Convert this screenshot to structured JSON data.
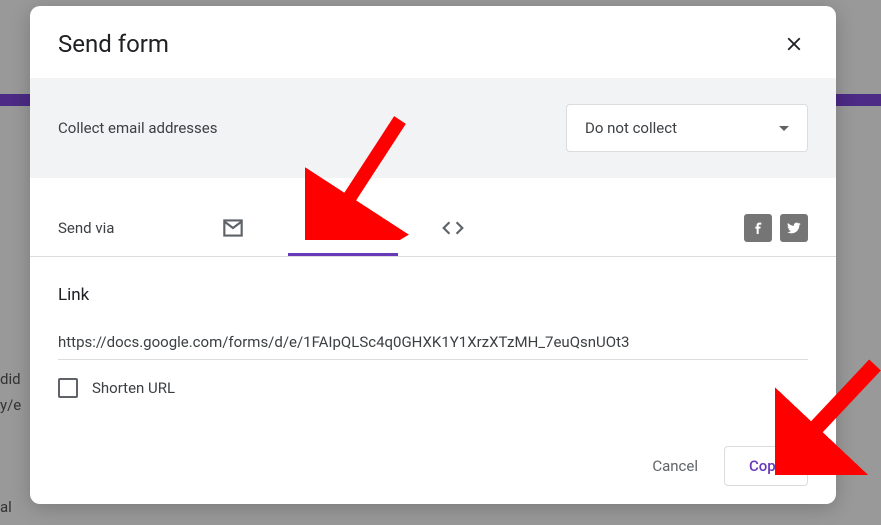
{
  "dialog": {
    "title": "Send form",
    "collect": {
      "label": "Collect email addresses",
      "selected": "Do not collect"
    },
    "send_via_label": "Send via",
    "link": {
      "heading": "Link",
      "url": "https://docs.google.com/forms/d/e/1FAIpQLSc4q0GHXK1Y1XrzXTzMH_7euQsnUOt3",
      "shorten_label": "Shorten URL"
    },
    "buttons": {
      "cancel": "Cancel",
      "copy": "Copy"
    }
  },
  "backdrop": {
    "text1": "did",
    "text2": "y/e",
    "text3": "al"
  }
}
